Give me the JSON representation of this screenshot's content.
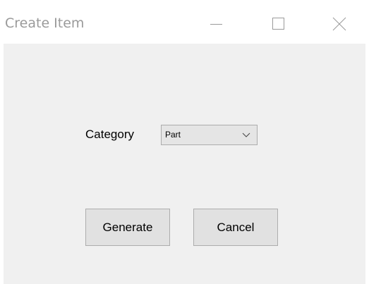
{
  "window": {
    "title": "Create Item"
  },
  "form": {
    "category_label": "Category",
    "category_value": "Part"
  },
  "buttons": {
    "generate_label": "Generate",
    "cancel_label": "Cancel"
  },
  "icons": {
    "minimize": "minimize-icon",
    "maximize": "maximize-icon",
    "close": "close-icon",
    "dropdown": "chevron-down-icon"
  },
  "colors": {
    "client_background": "#f0f0f0",
    "title_text": "#9a9a9a",
    "button_face": "#e1e1e1",
    "button_border": "#adadad"
  }
}
